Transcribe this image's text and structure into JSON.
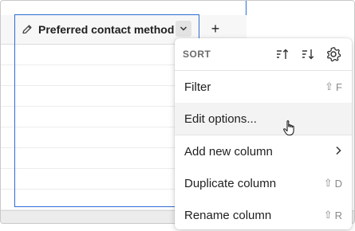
{
  "column": {
    "title": "Preferred contact method",
    "pencil_icon": "pencil-icon",
    "menu_icon": "chevron-down-icon",
    "add_icon": "plus-icon",
    "add_label": "+"
  },
  "menu": {
    "sort_label": "SORT",
    "sort_icons": [
      "sort-ascending-icon",
      "sort-descending-icon",
      "gear-icon"
    ],
    "items": [
      {
        "label": "Filter",
        "shortcut": "F",
        "shortcut_modifier": "⇧"
      },
      {
        "label": "Edit options...",
        "shortcut": "",
        "shortcut_modifier": "",
        "hovered": true
      },
      {
        "label": "Add new column",
        "shortcut": "",
        "submenu": true
      },
      {
        "label": "Duplicate column",
        "shortcut": "D",
        "shortcut_modifier": "⇧"
      },
      {
        "label": "Rename column",
        "shortcut": "R",
        "shortcut_modifier": "⇧"
      }
    ]
  },
  "colors": {
    "selection": "#2e6bd8",
    "menu_hover": "#f3f3f3"
  }
}
